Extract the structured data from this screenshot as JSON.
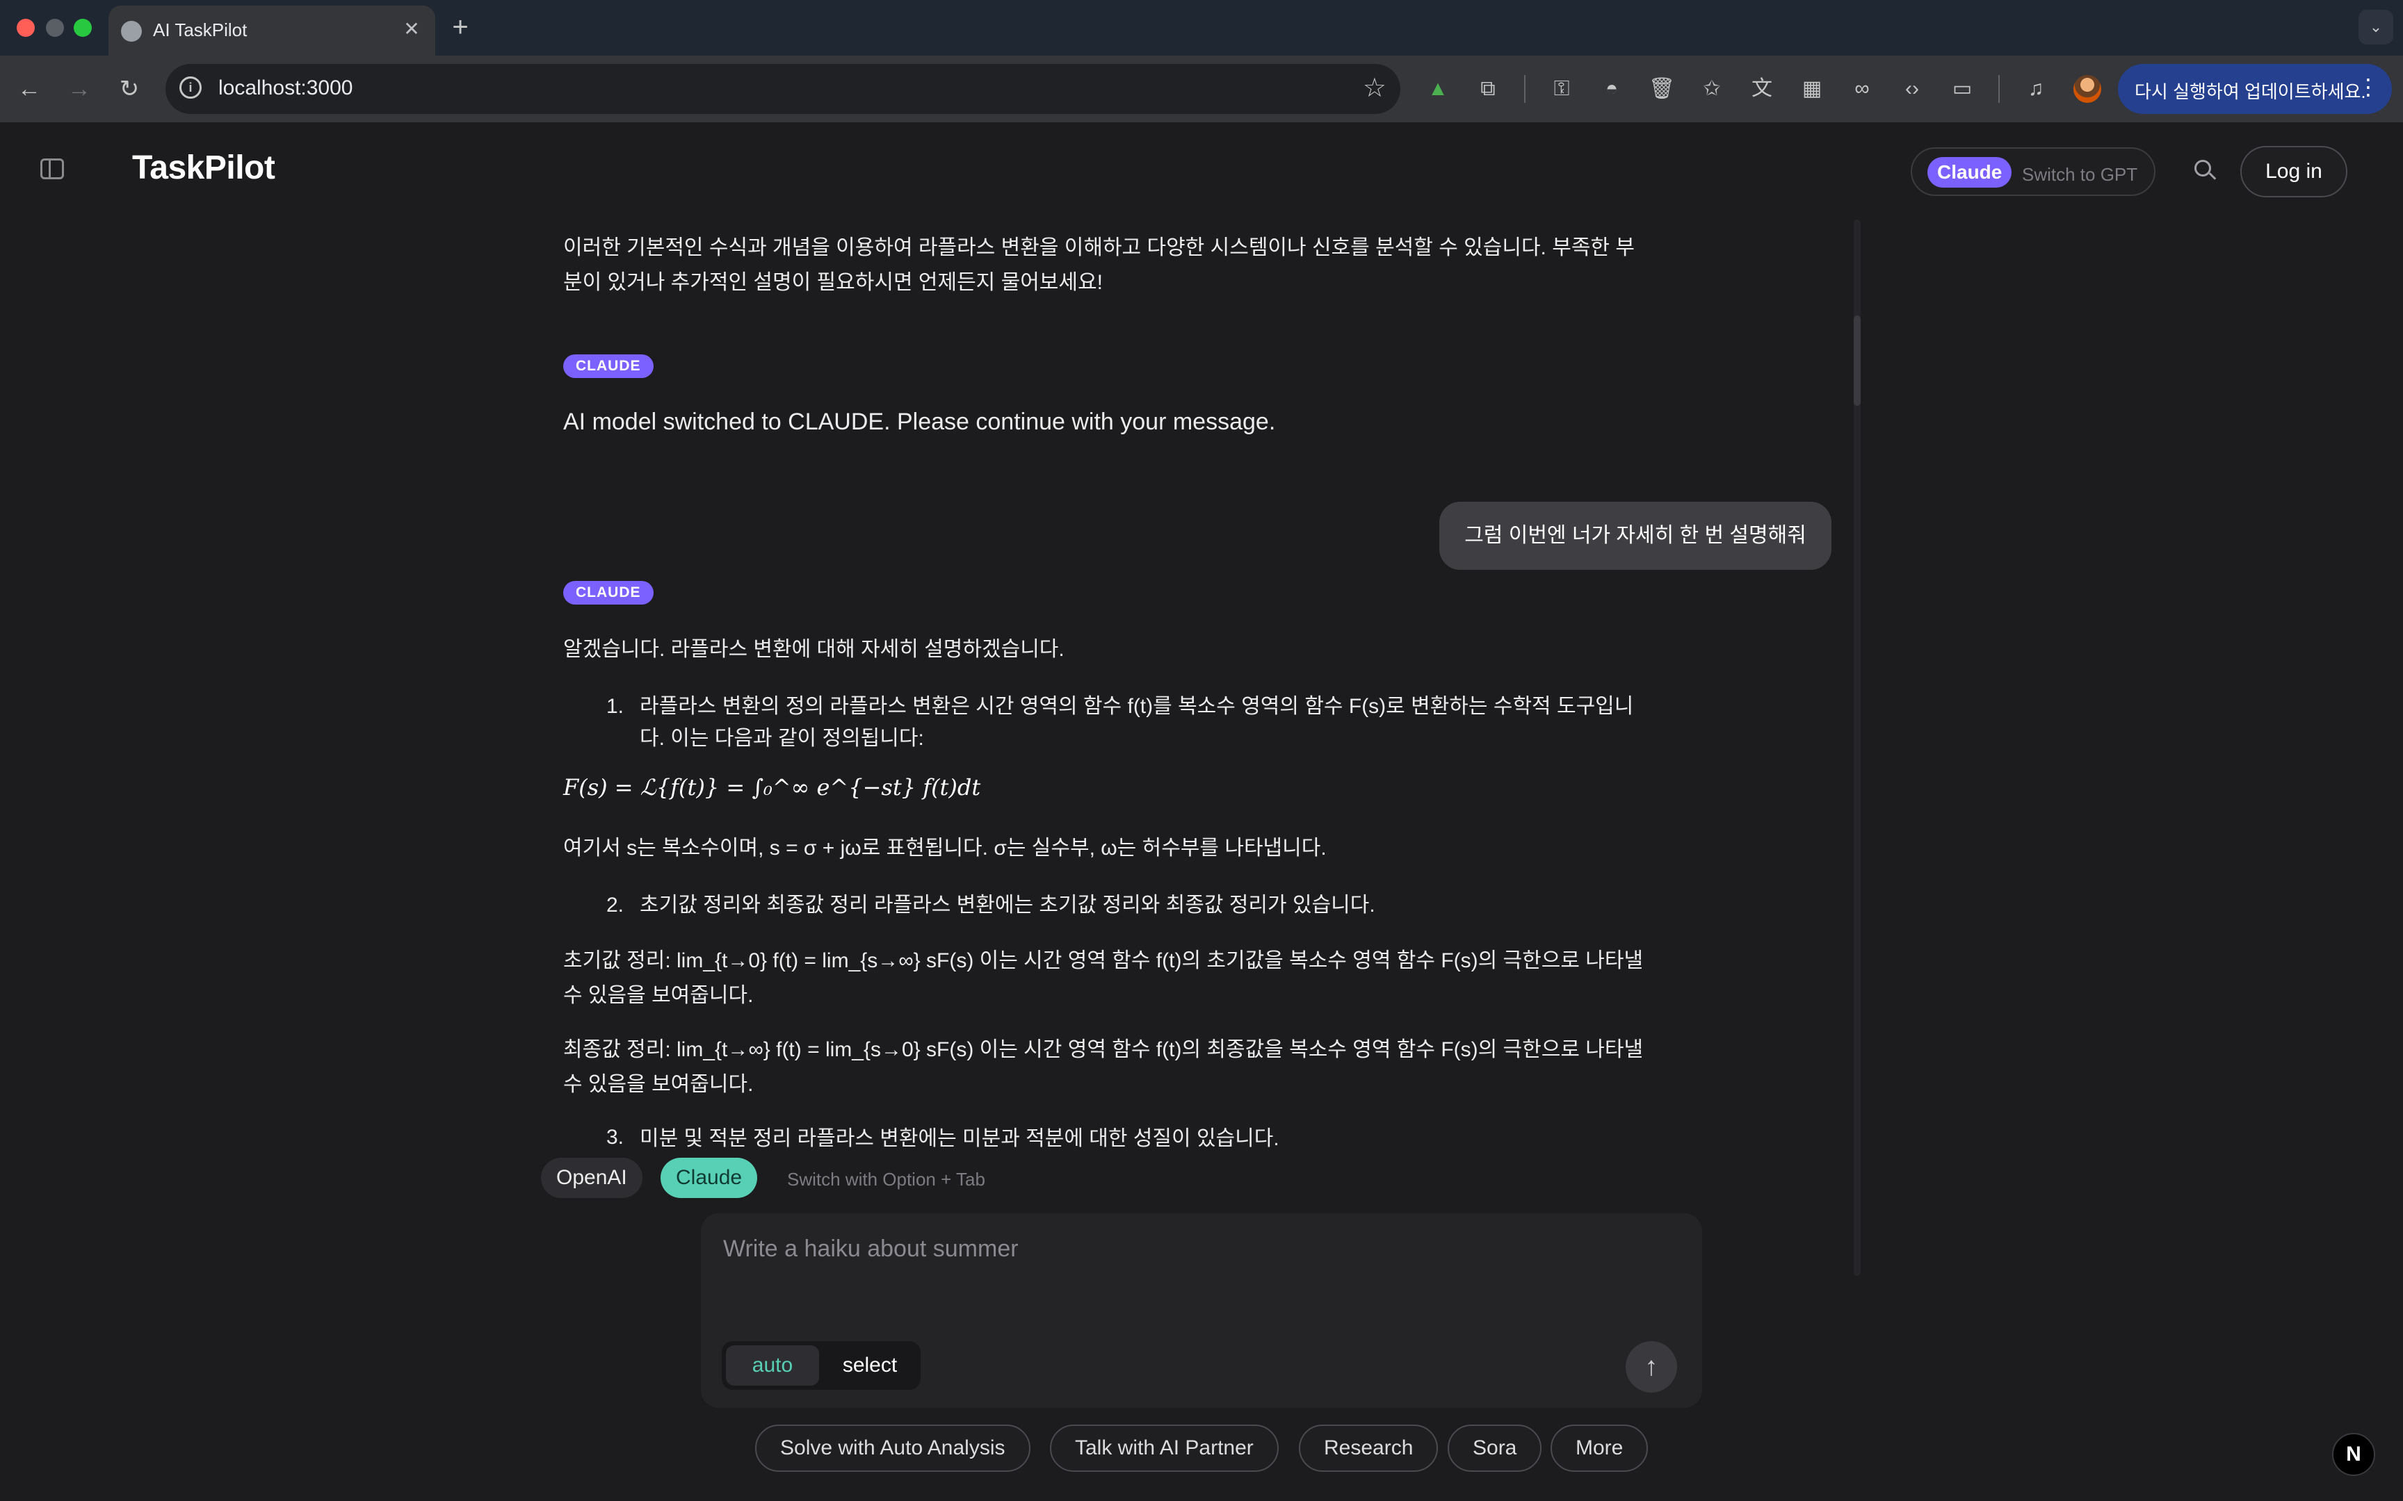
{
  "browser": {
    "tab_title": "AI TaskPilot",
    "new_tab_glyph": "+",
    "url": "localhost:3000",
    "update_button": "다시 실행하여 업데이트하세요.",
    "icons": [
      "back-icon",
      "forward-icon",
      "reload-icon",
      "site-info-icon",
      "bookmark-star-icon",
      "google-drive-icon",
      "extensions-icon",
      "password-icon",
      "incognito-icon",
      "trash-icon",
      "star-icon",
      "translate-icon",
      "qr-code-icon",
      "link-icon",
      "code-icon",
      "devices-icon",
      "media-icon",
      "profile-icon"
    ]
  },
  "header": {
    "brand": "TaskPilot",
    "model_current": "Claude",
    "model_switch_label": "Switch to GPT",
    "login_label": "Log in"
  },
  "chat": {
    "prev_answer_tail": "이러한 기본적인 수식과 개념을 이용하여 라플라스 변환을 이해하고 다양한 시스템이나 신호를 분석할 수 있습니다. 부족한 부분이 있거나 추가적인 설명이 필요하시면 언제든지 물어보세요!",
    "badge_1": "CLAUDE",
    "switch_notice": "AI model switched to CLAUDE. Please continue with your message.",
    "user_message": "그럼 이번엔 너가 자세히 한 번 설명해줘",
    "badge_2": "CLAUDE",
    "answer_intro": "알겠습니다. 라플라스 변환에 대해 자세히 설명하겠습니다.",
    "item1_num": "1.",
    "item1_text": "라플라스 변환의 정의 라플라스 변환은 시간 영역의 함수 f(t)를 복소수 영역의 함수 F(s)로 변환하는 수학적 도구입니다. 이는 다음과 같이 정의됩니다:",
    "formula_def": "F(s) = ℒ{f(t)} = ∫₀^∞ e^{−st} f(t)dt",
    "s_explain": "여기서 s는 복소수이며, s = σ + jω로 표현됩니다. σ는 실수부, ω는 허수부를 나타냅니다.",
    "item2_num": "2.",
    "item2_text": "초기값 정리와 최종값 정리 라플라스 변환에는 초기값 정리와 최종값 정리가 있습니다.",
    "initial_value": "초기값 정리: lim_{t→0} f(t) = lim_{s→∞} sF(s) 이는 시간 영역 함수 f(t)의 초기값을 복소수 영역 함수 F(s)의 극한으로 나타낼 수 있음을 보여줍니다.",
    "final_value": "최종값 정리: lim_{t→∞} f(t) = lim_{s→0} sF(s) 이는 시간 영역 함수 f(t)의 최종값을 복소수 영역 함수 F(s)의 극한으로 나타낼 수 있음을 보여줍니다.",
    "item3_num": "3.",
    "item3_text": "미분 및 적분 정리 라플라스 변환에는 미분과 적분에 대한 성질이 있습니다."
  },
  "providers": {
    "openai": "OpenAI",
    "claude": "Claude",
    "hint": "Switch with Option + Tab"
  },
  "composer": {
    "placeholder": "Write a haiku about summer",
    "mode_auto": "auto",
    "mode_select": "select",
    "send_glyph": "↑"
  },
  "quick_actions": [
    "Solve with Auto Analysis",
    "Talk with AI Partner",
    "Research",
    "Sora",
    "More"
  ],
  "dev_badge": "N",
  "colors": {
    "claude_purple": "#7b61ff",
    "active_teal": "#58d0b5",
    "background": "#1c1c1e",
    "update_blue": "#24408e"
  }
}
